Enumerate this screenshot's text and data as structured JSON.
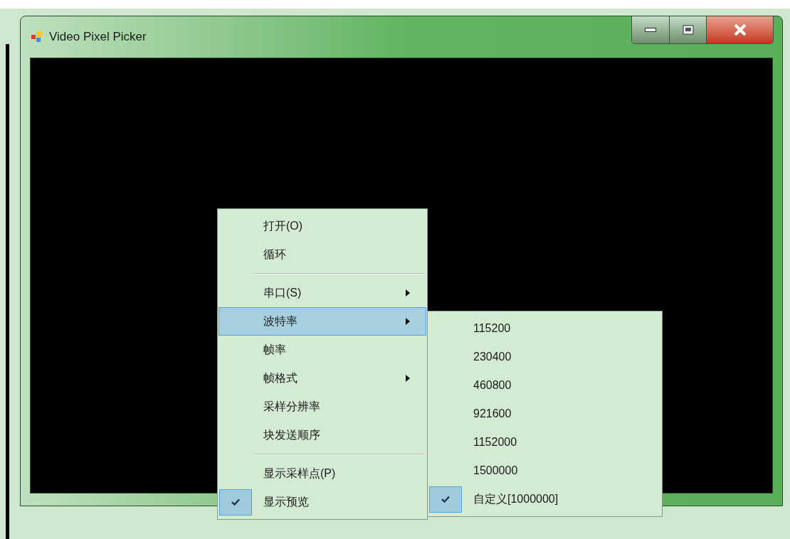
{
  "window": {
    "title": "Video Pixel Picker"
  },
  "context_menu": {
    "items": [
      {
        "kind": "item",
        "label": "打开(O)",
        "has_submenu": false,
        "checked": false,
        "selected": false
      },
      {
        "kind": "item",
        "label": "循环",
        "has_submenu": false,
        "checked": false,
        "selected": false
      },
      {
        "kind": "separator"
      },
      {
        "kind": "item",
        "label": "串口(S)",
        "has_submenu": true,
        "checked": false,
        "selected": false
      },
      {
        "kind": "item",
        "label": "波特率",
        "has_submenu": true,
        "checked": false,
        "selected": true
      },
      {
        "kind": "item",
        "label": "帧率",
        "has_submenu": false,
        "checked": false,
        "selected": false
      },
      {
        "kind": "item",
        "label": "帧格式",
        "has_submenu": true,
        "checked": false,
        "selected": false
      },
      {
        "kind": "item",
        "label": "采样分辨率",
        "has_submenu": false,
        "checked": false,
        "selected": false
      },
      {
        "kind": "item",
        "label": "块发送顺序",
        "has_submenu": false,
        "checked": false,
        "selected": false
      },
      {
        "kind": "separator"
      },
      {
        "kind": "item",
        "label": "显示采样点(P)",
        "has_submenu": false,
        "checked": false,
        "selected": false
      },
      {
        "kind": "item",
        "label": "显示预览",
        "has_submenu": false,
        "checked": true,
        "selected": false
      }
    ]
  },
  "submenu": {
    "items": [
      {
        "kind": "item",
        "label": "115200",
        "has_submenu": false,
        "checked": false,
        "selected": false
      },
      {
        "kind": "item",
        "label": "230400",
        "has_submenu": false,
        "checked": false,
        "selected": false
      },
      {
        "kind": "item",
        "label": "460800",
        "has_submenu": false,
        "checked": false,
        "selected": false
      },
      {
        "kind": "item",
        "label": "921600",
        "has_submenu": false,
        "checked": false,
        "selected": false
      },
      {
        "kind": "item",
        "label": "1152000",
        "has_submenu": false,
        "checked": false,
        "selected": false
      },
      {
        "kind": "item",
        "label": "1500000",
        "has_submenu": false,
        "checked": false,
        "selected": false
      },
      {
        "kind": "item",
        "label": "自定义[1000000]",
        "has_submenu": false,
        "checked": true,
        "selected": false
      }
    ]
  }
}
